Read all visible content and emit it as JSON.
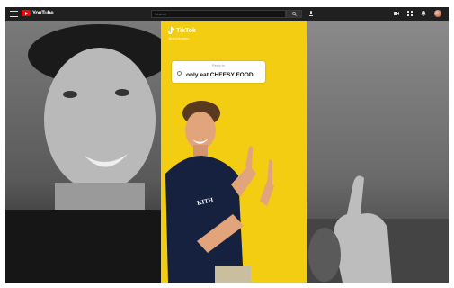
{
  "topbar": {
    "logo_text": "YouTube",
    "search_placeholder": "Search"
  },
  "tiktok": {
    "logo_text": "TikTok",
    "handle": "@nickdimatteo",
    "reply_small": "Reply to",
    "reply_text": "only eat CHEESY FOOD"
  },
  "shirt": {
    "brand_text": "KITH"
  },
  "colors": {
    "yellow_bg": "#f3cd12",
    "youtube_red": "#ff0000",
    "shirt_navy": "#16203f"
  }
}
